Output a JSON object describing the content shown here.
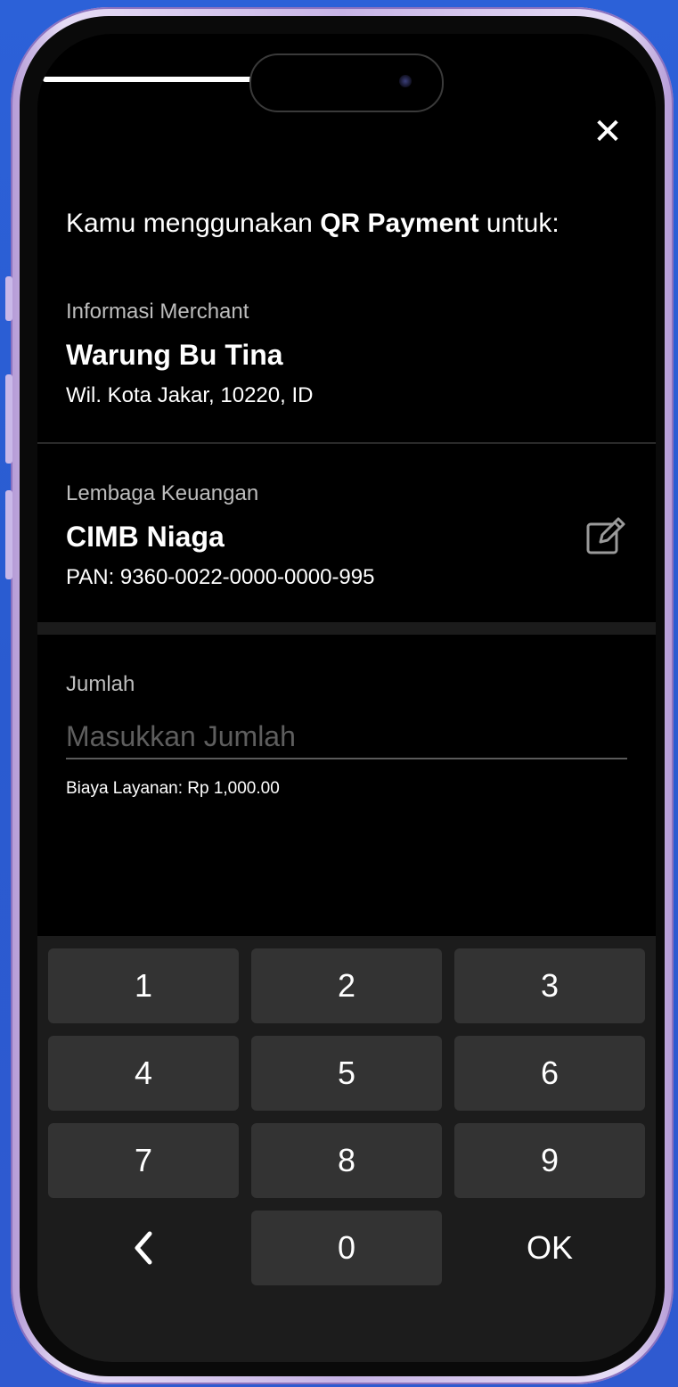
{
  "colors": {
    "background_blue": "#2c61d8",
    "phone_frame": "#c7b4e6",
    "screen": "#000000",
    "key": "#333333",
    "keypad_bg": "#1c1c1c"
  },
  "header": {
    "close_icon": "close-icon",
    "close_symbol": "✕"
  },
  "heading": {
    "prefix": "Kamu menggunakan ",
    "bold": "QR Payment",
    "suffix": " untuk:"
  },
  "merchant": {
    "label": "Informasi Merchant",
    "name": "Warung Bu Tina",
    "location": "Wil. Kota Jakar, 10220, ID"
  },
  "institution": {
    "label": "Lembaga Keuangan",
    "name": "CIMB Niaga",
    "pan": "PAN: 9360-0022-0000-0000-995",
    "edit_icon": "edit-icon"
  },
  "amount": {
    "label": "Jumlah",
    "placeholder": "Masukkan Jumlah",
    "value": "",
    "fee": "Biaya Layanan: Rp 1,000.00"
  },
  "keypad": {
    "keys": [
      {
        "label": "1"
      },
      {
        "label": "2"
      },
      {
        "label": "3"
      },
      {
        "label": "4"
      },
      {
        "label": "5"
      },
      {
        "label": "6"
      },
      {
        "label": "7"
      },
      {
        "label": "8"
      },
      {
        "label": "9"
      },
      {
        "label": "‹",
        "icon": "backspace-chevron-icon"
      },
      {
        "label": "0"
      },
      {
        "label": "OK"
      }
    ]
  }
}
